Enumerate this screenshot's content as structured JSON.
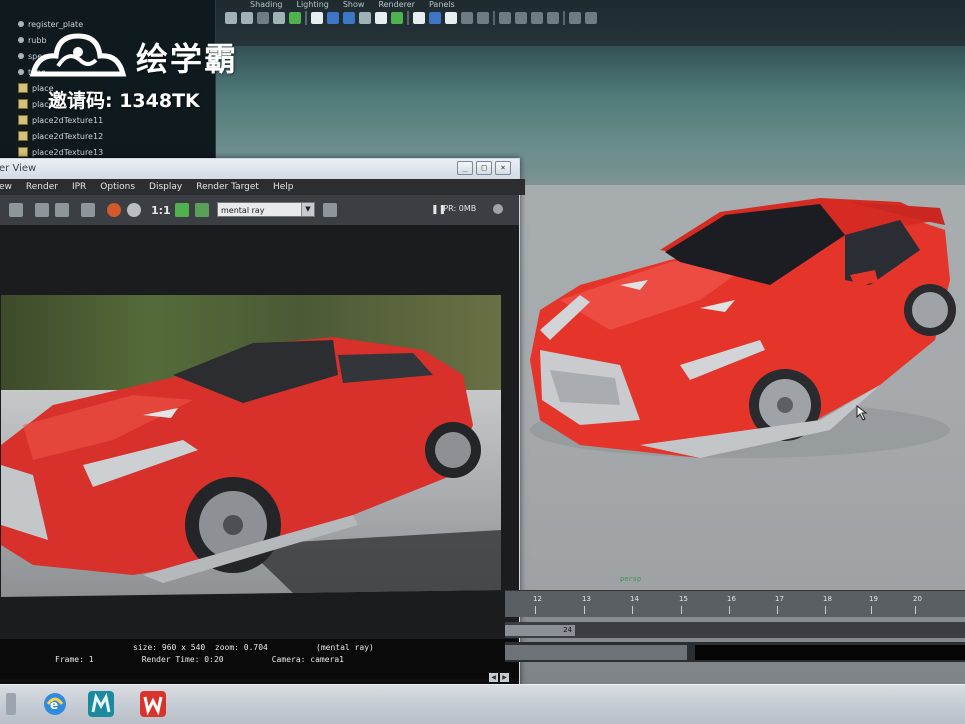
{
  "watermark": {
    "brand": "绘学霸",
    "invite_code": "邀请码: 1348TK"
  },
  "maya_menu": [
    "Shading",
    "Lighting",
    "Show",
    "Renderer",
    "Panels"
  ],
  "outliner": {
    "items": [
      {
        "label": "register_plate",
        "icon": "dot-icon"
      },
      {
        "label": "rubb",
        "icon": "dot-icon"
      },
      {
        "label": "spec",
        "icon": "dot-icon"
      },
      {
        "label": "type",
        "icon": "dot-icon"
      },
      {
        "label": "place",
        "icon": "place2d-node-icon"
      },
      {
        "label": "place",
        "icon": "place2d-node-icon"
      },
      {
        "label": "place2dTexture11",
        "icon": "place2d-node-icon"
      },
      {
        "label": "place2dTexture12",
        "icon": "place2d-node-icon"
      },
      {
        "label": "place2dTexture13",
        "icon": "place2d-node-icon"
      }
    ]
  },
  "render_view": {
    "title": "er View",
    "menu": [
      "ew",
      "Render",
      "IPR",
      "Options",
      "Display",
      "Render Target",
      "Help"
    ],
    "zoom_label": "1:1",
    "renderer": "mental ray",
    "ipr_label": "IPR: 0MB",
    "info": {
      "line1": "size: 960 x 540  zoom: 0.704          (mental ray)",
      "line2": "Frame: 1          Render Time: 0:20          Camera: camera1"
    }
  },
  "viewport": {
    "camera_label": "persp"
  },
  "timeline": {
    "ticks": [
      "12",
      "13",
      "14",
      "15",
      "16",
      "17",
      "18",
      "19",
      "20"
    ],
    "range_end": "24"
  },
  "taskbar": {
    "icons": [
      "internet-explorer-icon",
      "maya-icon",
      "wps-office-icon"
    ]
  },
  "colors": {
    "car_red": "#e8332a",
    "viewport_gray": "#a6aaad",
    "taskbar": "#c6ccd3"
  }
}
